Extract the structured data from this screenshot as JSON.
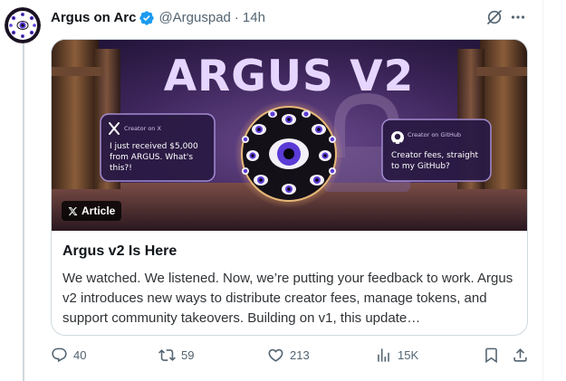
{
  "author": {
    "display_name": "Argus on Arc",
    "handle": "@Arguspad",
    "separator": "·",
    "time": "14h",
    "verified": true,
    "avatar_icon": "eye-sphere-avatar"
  },
  "top_actions": {
    "grok_icon": "grok-slash-icon",
    "more_icon": "more-horizontal-icon"
  },
  "article": {
    "image": {
      "headline": "ARGUS V2",
      "left_bubble": {
        "platform_label": "Creator on X",
        "quote": [
          "I just received $5,000",
          "from ARGUS. What's",
          "this?!"
        ],
        "icon": "x-logo-icon"
      },
      "right_bubble": {
        "platform_label": "Creator on GitHub",
        "quote": [
          "Creator fees, straight",
          "to my GitHub?"
        ],
        "icon": "github-logo-icon"
      }
    },
    "badge_label": "Article",
    "title": "Argus v2 Is Here",
    "description": "We watched. We listened. Now, we’re putting your feedback to work. Argus v2 introduces new ways to distribute creator fees, manage tokens, and support community takeovers. Building on v1, this update…"
  },
  "actions": {
    "replies": "40",
    "reposts": "59",
    "likes": "213",
    "views": "15K"
  },
  "colors": {
    "text_primary": "#0f1419",
    "text_secondary": "#536471",
    "verified_blue": "#1d9bf0",
    "card_border": "#cfd9de",
    "hero_purple": "#3b2458",
    "headline_lavender": "#e6d6ff"
  }
}
